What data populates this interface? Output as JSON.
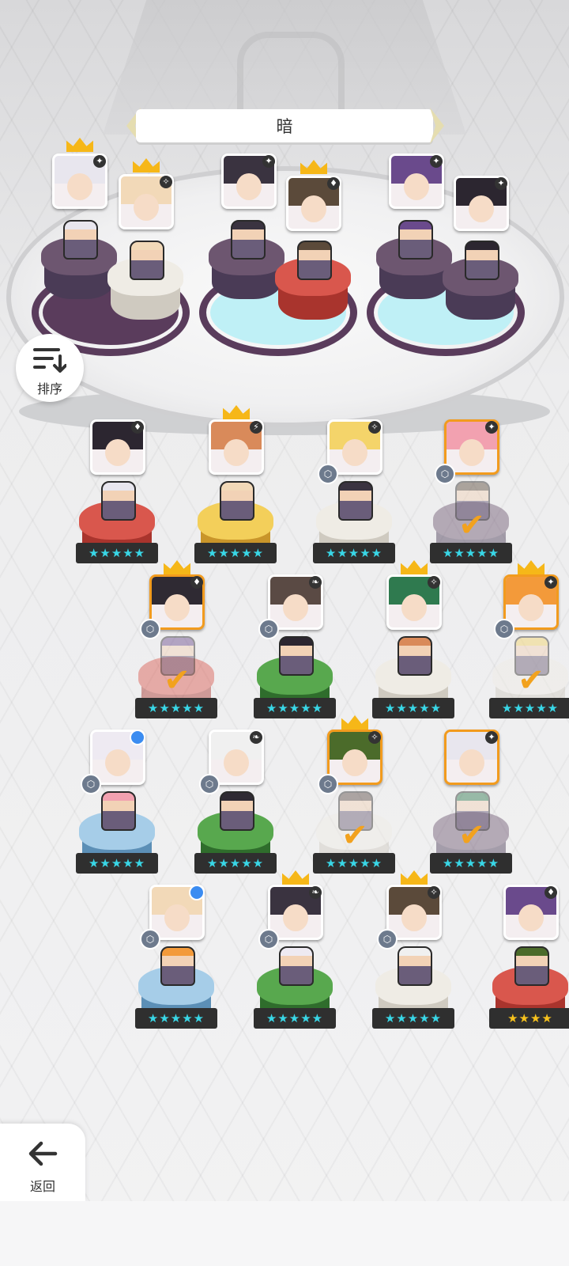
{
  "title": "暗",
  "colors": {
    "dark": "#4a3b56",
    "white": "#e9e7e2",
    "red": "#c9443c",
    "yellow": "#e9b83b",
    "green": "#3f8c3c",
    "blue": "#7fb3d8",
    "selected_border": "#f29b1e",
    "star_cyan": "#39d6e6",
    "star_gold": "#f7c21d"
  },
  "formation": {
    "slots": [
      {
        "left_char": "white-hair-girl",
        "right_char": "blonde-sleeping-girl",
        "left_ped": "dark",
        "right_ped": "white"
      },
      {
        "left_char": "masked-dark-girl",
        "right_char": "dark-armored-boy",
        "left_ped": "dark",
        "right_ped": "red"
      },
      {
        "left_char": "purple-hooded-girl",
        "right_char": "black-hair-girl",
        "left_ped": "dark",
        "right_ped": "dark"
      }
    ],
    "portraits": [
      {
        "element_icon": "dark-element-icon",
        "element_glyph": "✦",
        "crown": true
      },
      {
        "element_icon": "light-element-icon",
        "element_glyph": "✧",
        "crown": true
      },
      {
        "element_icon": "dark-element-icon",
        "element_glyph": "✦",
        "crown": false
      },
      {
        "element_icon": "fire-element-icon",
        "element_glyph": "♦",
        "crown": true
      },
      {
        "element_icon": "dark-element-icon",
        "element_glyph": "✦",
        "crown": false
      },
      {
        "element_icon": "dark-element-icon",
        "element_glyph": "✦",
        "crown": false
      }
    ]
  },
  "sort_button": {
    "label": "排序",
    "icon": "sort-icon"
  },
  "back_button": {
    "label": "返回",
    "icon": "back-arrow-icon"
  },
  "roster": [
    {
      "ped": "red",
      "stars": "★★★★★",
      "star_color": "cyan",
      "crown": false,
      "cube": false,
      "element": "♦",
      "assigned": false,
      "dot": false
    },
    {
      "ped": "yellow",
      "stars": "★★★★★",
      "star_color": "cyan",
      "crown": true,
      "cube": false,
      "element": "⚡",
      "assigned": false,
      "dot": false
    },
    {
      "ped": "white",
      "stars": "★★★★★",
      "star_color": "cyan",
      "crown": false,
      "cube": true,
      "element": "✧",
      "assigned": false,
      "dot": false
    },
    {
      "ped": "dark",
      "stars": "★★★★★",
      "star_color": "cyan",
      "crown": false,
      "cube": true,
      "element": "✦",
      "assigned": true,
      "dot": false
    },
    {
      "ped": "red",
      "stars": "★★★★★",
      "star_color": "cyan",
      "crown": true,
      "cube": true,
      "element": "♦",
      "assigned": true,
      "dot": false
    },
    {
      "ped": "green",
      "stars": "★★★★★",
      "star_color": "cyan",
      "crown": false,
      "cube": true,
      "element": "❧",
      "assigned": false,
      "dot": false
    },
    {
      "ped": "white",
      "stars": "★★★★★",
      "star_color": "cyan",
      "crown": true,
      "cube": false,
      "element": "✧",
      "assigned": false,
      "dot": false
    },
    {
      "ped": "white",
      "stars": "★★★★★",
      "star_color": "cyan",
      "crown": true,
      "cube": true,
      "element": "✦",
      "assigned": true,
      "dot": false
    },
    {
      "ped": "blue",
      "stars": "★★★★★",
      "star_color": "cyan",
      "crown": false,
      "cube": true,
      "element": "",
      "assigned": false,
      "dot": true
    },
    {
      "ped": "green",
      "stars": "★★★★★",
      "star_color": "cyan",
      "crown": false,
      "cube": true,
      "element": "❧",
      "assigned": false,
      "dot": false
    },
    {
      "ped": "white",
      "stars": "★★★★★",
      "star_color": "cyan",
      "crown": true,
      "cube": true,
      "element": "✧",
      "assigned": true,
      "dot": false
    },
    {
      "ped": "dark",
      "stars": "★★★★★",
      "star_color": "cyan",
      "crown": false,
      "cube": false,
      "element": "✦",
      "assigned": true,
      "dot": false
    },
    {
      "ped": "blue",
      "stars": "★★★★★",
      "star_color": "cyan",
      "crown": false,
      "cube": true,
      "element": "",
      "assigned": false,
      "dot": true
    },
    {
      "ped": "green",
      "stars": "★★★★★",
      "star_color": "cyan",
      "crown": true,
      "cube": true,
      "element": "❧",
      "assigned": false,
      "dot": false
    },
    {
      "ped": "white",
      "stars": "★★★★★",
      "star_color": "cyan",
      "crown": true,
      "cube": true,
      "element": "✧",
      "assigned": false,
      "dot": false
    },
    {
      "ped": "red",
      "stars": "★★★★",
      "star_color": "gold",
      "crown": false,
      "cube": false,
      "element": "♦",
      "assigned": false,
      "dot": false
    }
  ]
}
